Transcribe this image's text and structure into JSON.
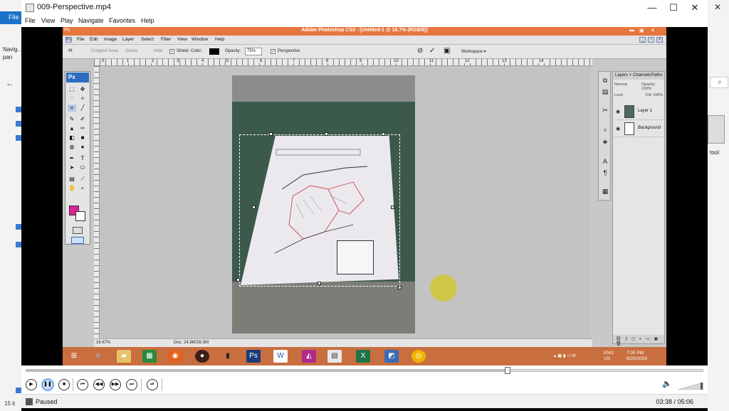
{
  "background_explorer": {
    "file_tab": "File",
    "nav_pane_label": "Navig… pan",
    "items_count": "15 it",
    "tool_label": "tool"
  },
  "player": {
    "window_title": "009-Perspective.mp4",
    "menu": [
      "File",
      "View",
      "Play",
      "Navigate",
      "Favorites",
      "Help"
    ],
    "status": "Paused",
    "time": "03:38 / 05:06",
    "progress": 0.713
  },
  "photoshop": {
    "title": "Adobe Photoshop CS3 - [Untitled-1 @ 16.7% (RGB/8)]",
    "menu": [
      "File",
      "Edit",
      "Image",
      "Layer",
      "Select",
      "Filter",
      "View",
      "Window",
      "Help"
    ],
    "options": {
      "cropped_area": "Cropped Area:",
      "delete": "Delete",
      "hide": "Hide",
      "shield": "Shield",
      "color": "Color:",
      "opacity_label": "Opacity:",
      "opacity_value": "75%",
      "perspective": "Perspective",
      "workspace": "Workspace ▾"
    },
    "ruler_marks": [
      "0",
      "1",
      "2",
      "3",
      "4",
      "5",
      "6",
      "7",
      "8",
      "9",
      "10",
      "11",
      "12",
      "13",
      "14"
    ],
    "toolbox_logo": "Ps",
    "status_zoom": "16.67%",
    "status_doc": "Doc: 24.9M/26.5M",
    "layers_panel": {
      "tabs": [
        "Layers ×",
        "Channels",
        "Paths"
      ],
      "blend_mode": "Normal",
      "opacity": "Opacity: 100%",
      "lock": "Lock:",
      "fill": "Fill: 100%",
      "layers": [
        "Layer 1",
        "Background"
      ]
    },
    "corner_badge": "Ps"
  },
  "taskbar": {
    "lang_top": "ENG",
    "lang_bottom": "US",
    "clock_time": "7:05 PM",
    "clock_date": "8/20/2018"
  }
}
